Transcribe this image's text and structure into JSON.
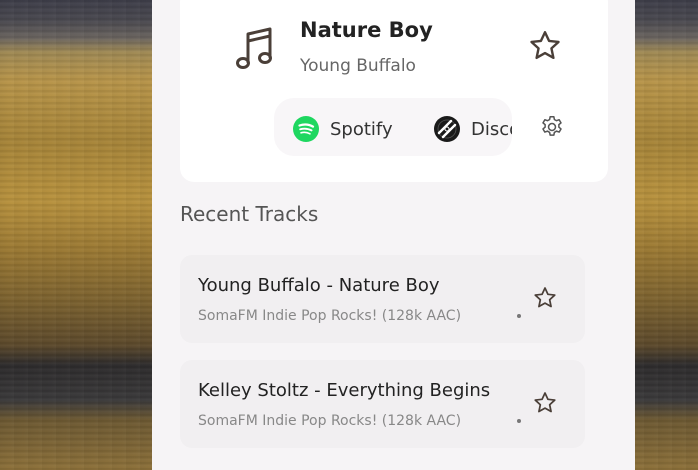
{
  "now_playing": {
    "title": "Nature Boy",
    "artist": "Young Buffalo",
    "icon": "music-note-icon",
    "favorite_icon": "star-outline-icon",
    "services": [
      {
        "label": "Spotify",
        "icon": "spotify-icon",
        "color": "#1ed760"
      },
      {
        "label": "Discogs",
        "icon": "discogs-icon",
        "color": "#1a1a1a"
      }
    ],
    "settings_icon": "gear-icon"
  },
  "recent": {
    "title": "Recent Tracks",
    "items": [
      {
        "title": "Young Buffalo - Nature Boy",
        "station": "SomaFM Indie Pop Rocks! (128k AAC)"
      },
      {
        "title": "Kelley Stoltz - Everything Begins",
        "station": "SomaFM Indie Pop Rocks! (128k AAC)"
      }
    ]
  },
  "colors": {
    "panel": "#f6f4f6",
    "card": "#ffffff",
    "spotify": "#1ed760"
  }
}
